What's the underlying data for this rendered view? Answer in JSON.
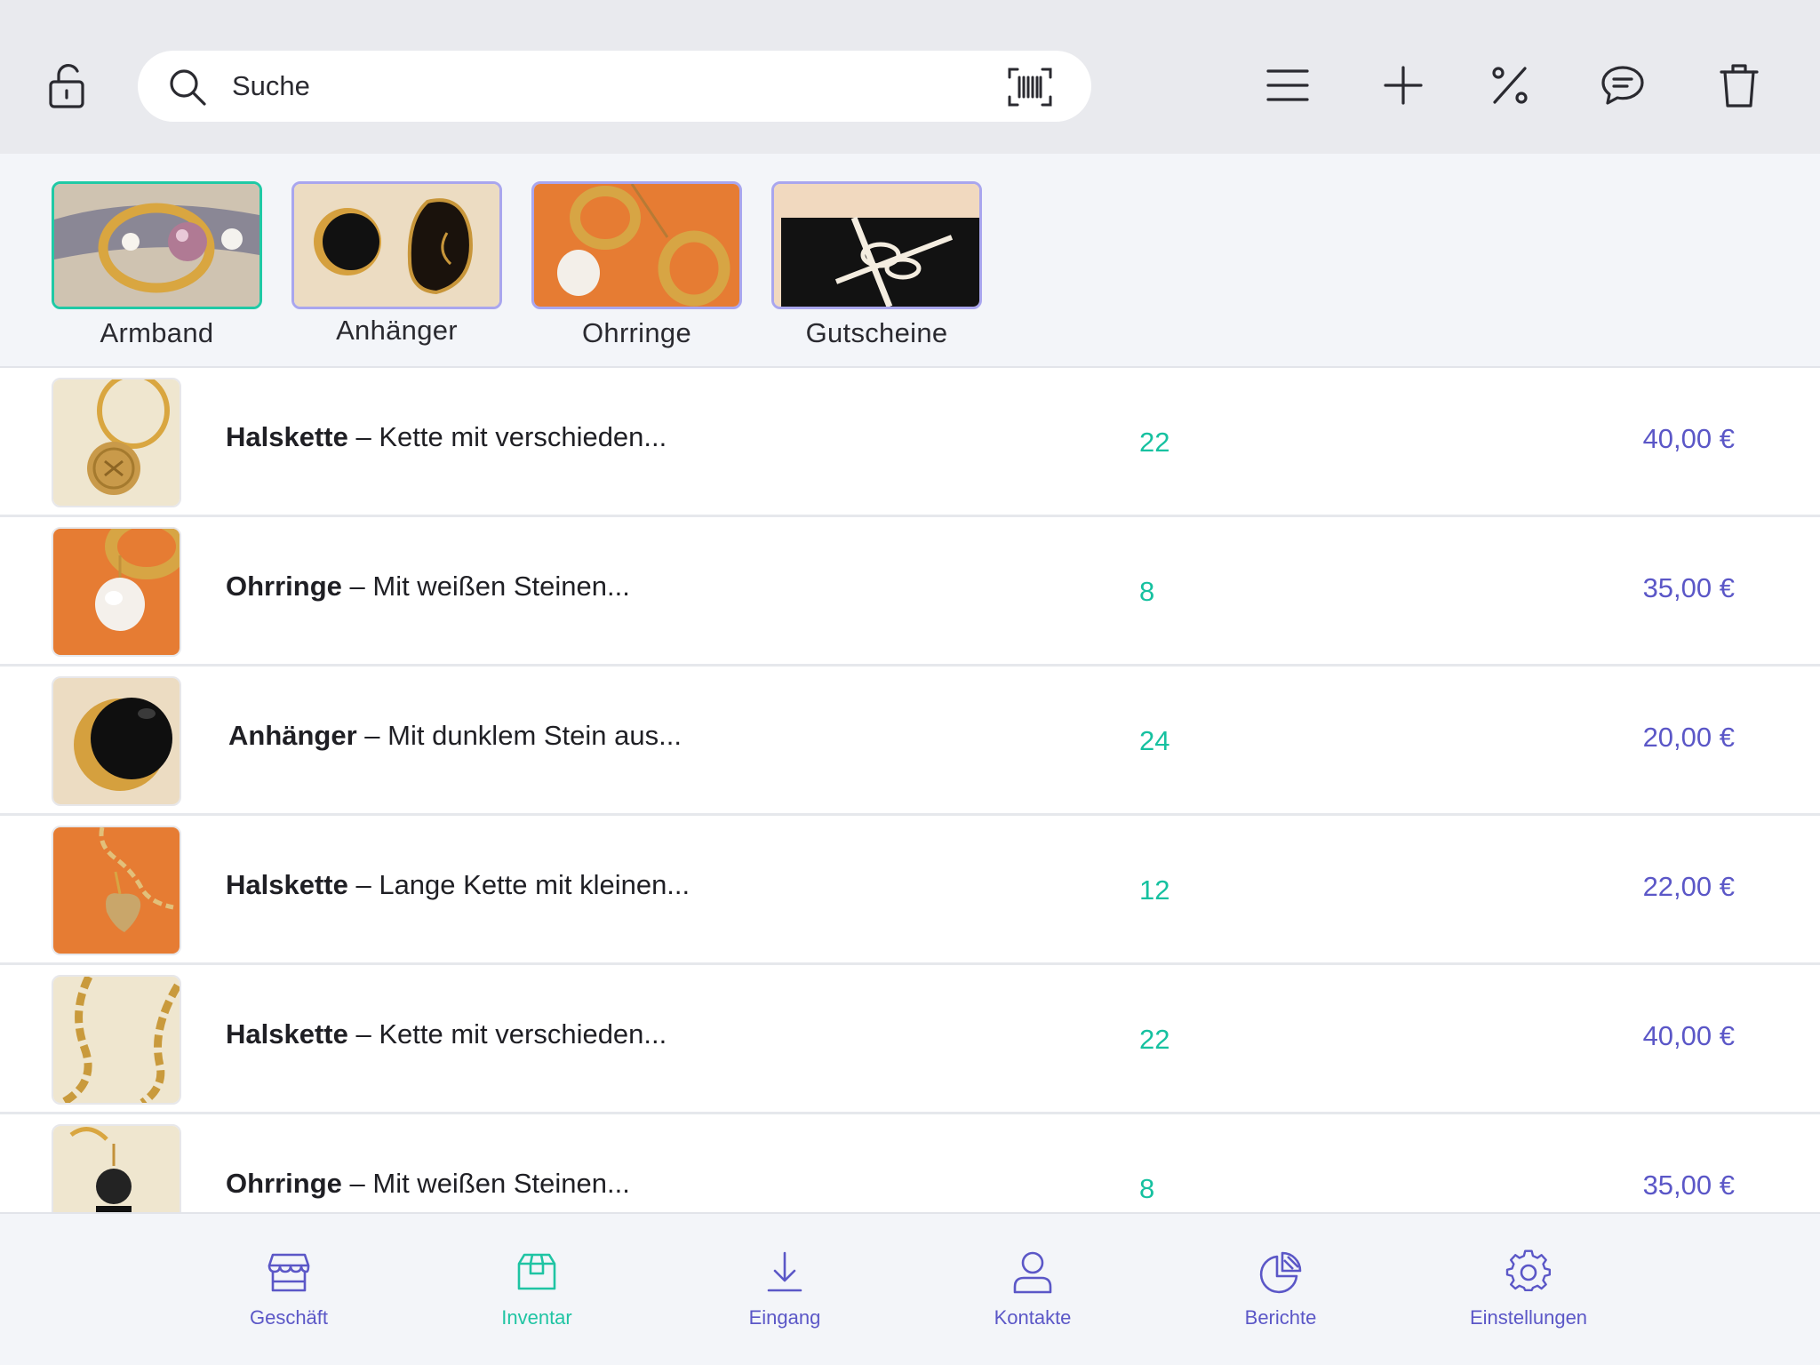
{
  "toolbar": {
    "search_placeholder": "Suche",
    "icons": [
      "lock-open-icon",
      "search-icon",
      "barcode-icon",
      "menu-icon",
      "plus-icon",
      "percent-icon",
      "chat-icon",
      "trash-icon"
    ]
  },
  "categories": [
    {
      "label": "Armband",
      "active": true
    },
    {
      "label": "Anhänger",
      "active": false
    },
    {
      "label": "Ohrringe",
      "active": false
    },
    {
      "label": "Gutscheine",
      "active": false
    }
  ],
  "products": [
    {
      "name": "Halskette",
      "desc": " – Kette mit verschieden...",
      "qty": "22",
      "price": "40,00 €"
    },
    {
      "name": "Ohrringe",
      "desc": " – Mit weißen Steinen...",
      "qty": "8",
      "price": "35,00 €"
    },
    {
      "name": "Anhänger",
      "desc": " – Mit dunklem Stein aus...",
      "qty": "24",
      "price": "20,00 €"
    },
    {
      "name": "Halskette",
      "desc": " – Lange Kette mit kleinen...",
      "qty": "12",
      "price": "22,00 €"
    },
    {
      "name": "Halskette",
      "desc": " – Kette mit verschieden...",
      "qty": "22",
      "price": "40,00 €"
    },
    {
      "name": "Ohrringe",
      "desc": " – Mit weißen Steinen...",
      "qty": "8",
      "price": "35,00 €"
    }
  ],
  "nav": [
    {
      "label": "Geschäft",
      "icon": "store-icon",
      "active": false
    },
    {
      "label": "Inventar",
      "icon": "box-icon",
      "active": true
    },
    {
      "label": "Eingang",
      "icon": "download-icon",
      "active": false
    },
    {
      "label": "Kontakte",
      "icon": "person-icon",
      "active": false
    },
    {
      "label": "Berichte",
      "icon": "pie-chart-icon",
      "active": false
    },
    {
      "label": "Einstellungen",
      "icon": "gear-icon",
      "active": false
    }
  ],
  "colors": {
    "accent_teal": "#20c9a5",
    "accent_purple": "#5b57c7",
    "toolbar_bg": "#e9eaee",
    "strip_bg": "#f3f5f9"
  }
}
